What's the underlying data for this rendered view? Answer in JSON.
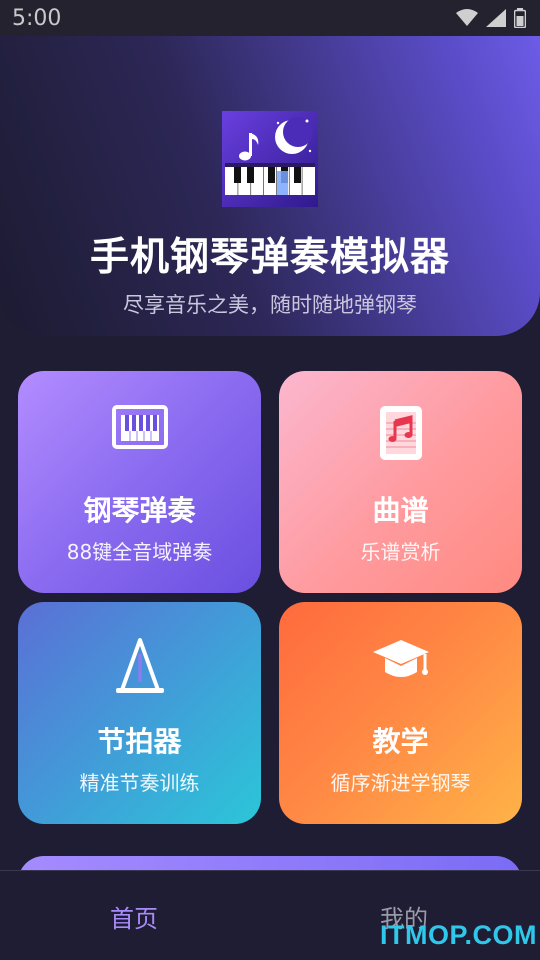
{
  "status_bar": {
    "time": "5:00",
    "icons": [
      "wifi-icon",
      "signal-icon",
      "battery-icon"
    ]
  },
  "hero": {
    "title": "手机钢琴弹奏模拟器",
    "subtitle": "尽享音乐之美，随时随地弹钢琴",
    "app_icon": "piano-moon-app-icon"
  },
  "cards": [
    {
      "title": "钢琴弹奏",
      "subtitle": "88键全音域弹奏",
      "icon": "piano-keyboard-icon"
    },
    {
      "title": "曲谱",
      "subtitle": "乐谱赏析",
      "icon": "sheet-music-icon"
    },
    {
      "title": "节拍器",
      "subtitle": "精准节奏训练",
      "icon": "metronome-icon"
    },
    {
      "title": "教学",
      "subtitle": "循序渐进学钢琴",
      "icon": "graduation-cap-icon"
    }
  ],
  "bottom_nav": {
    "items": [
      {
        "label": "首页",
        "active": true
      },
      {
        "label": "我的",
        "active": false
      }
    ],
    "active_color": "#a78bfa"
  },
  "watermark": "ITMOP.COM"
}
